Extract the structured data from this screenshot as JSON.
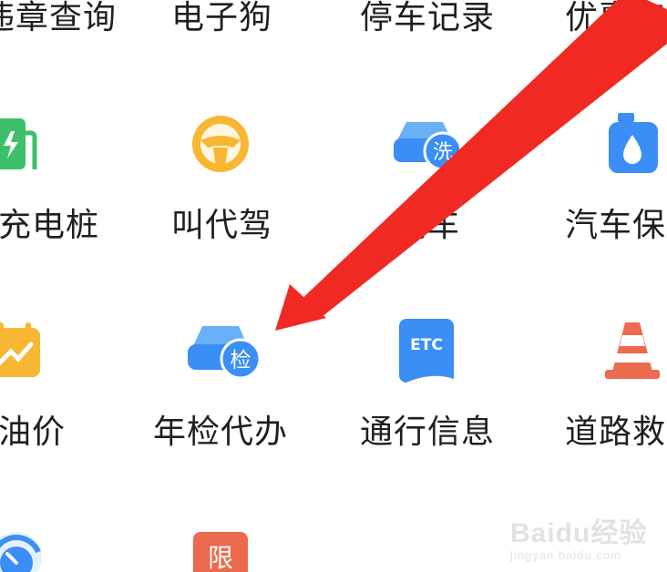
{
  "services": [
    {
      "label": "违章查询",
      "icon": "violation-query-icon"
    },
    {
      "label": "电子狗",
      "icon": "electronic-dog-icon"
    },
    {
      "label": "停车记录",
      "icon": "parking-record-icon"
    },
    {
      "label": "优惠加油",
      "icon": "discount-fuel-icon"
    },
    {
      "label": "充电桩",
      "icon": "charging-pile-icon"
    },
    {
      "label": "叫代驾",
      "icon": "steering-wheel-icon",
      "color": "#f7b733"
    },
    {
      "label": "洗车",
      "icon": "car-wash-icon",
      "badge": "洗"
    },
    {
      "label": "汽车保养",
      "icon": "oil-bottle-icon"
    },
    {
      "label": "油价",
      "icon": "fuel-price-calendar-icon"
    },
    {
      "label": "年检代办",
      "icon": "annual-inspection-icon",
      "badge": "检"
    },
    {
      "label": "通行信息",
      "icon": "etc-icon",
      "badge": "ETC"
    },
    {
      "label": "道路救援",
      "icon": "traffic-cone-icon"
    },
    {
      "label": "",
      "icon": "speed-gauge-icon"
    },
    {
      "label": "",
      "icon": "traffic-restriction-icon",
      "badge": "限"
    }
  ],
  "watermark": {
    "brand": "Baidu经验",
    "url": "jingyan.baidu.com"
  },
  "colors": {
    "arrow": "#f02a22",
    "blue": "#3a8ef6",
    "green": "#3ec06a",
    "orange": "#f7b733",
    "cone": "#ec6a4d"
  }
}
